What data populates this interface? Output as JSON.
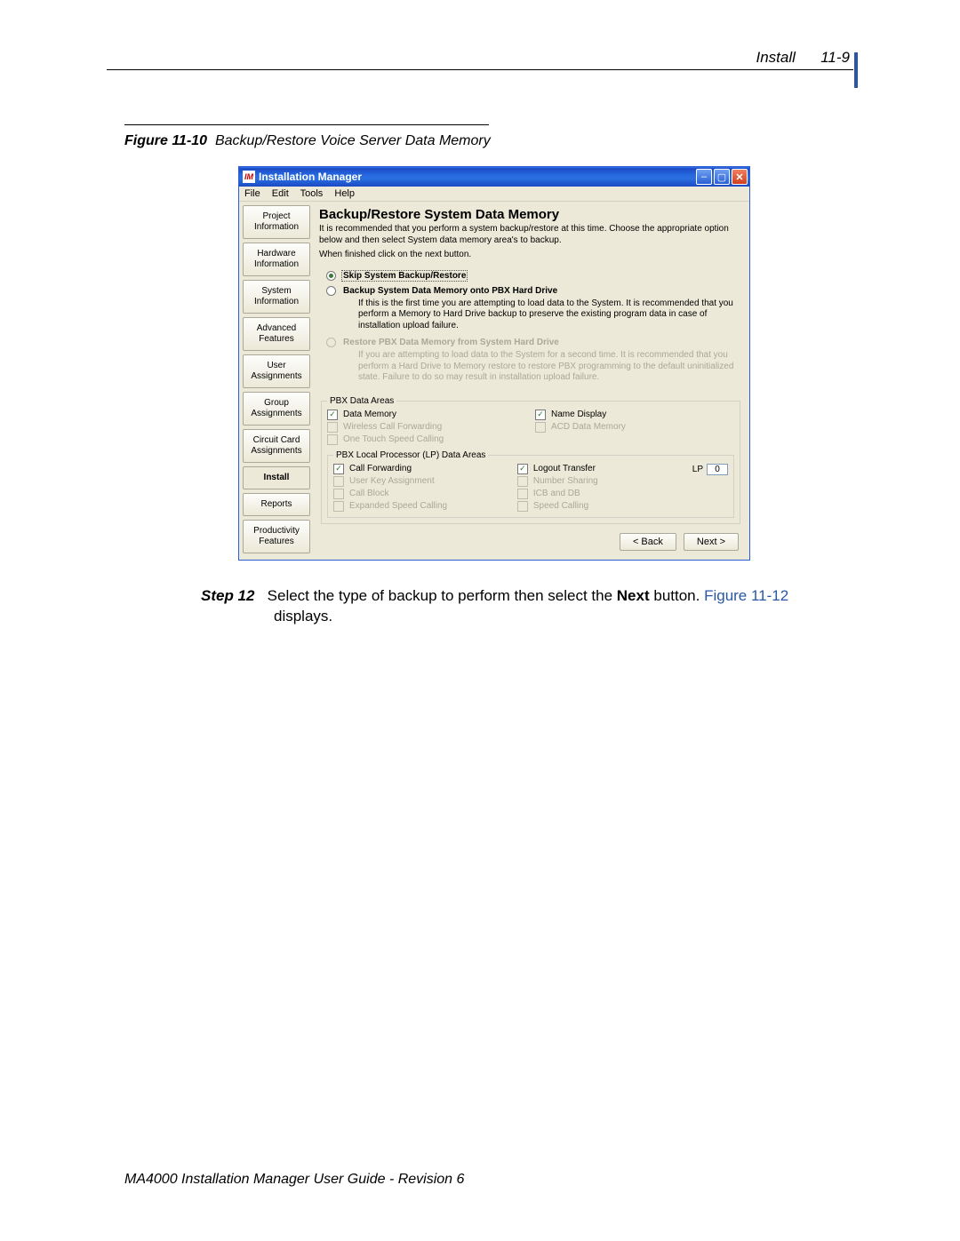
{
  "document": {
    "header_section": "Install",
    "header_page": "11-9",
    "figure_label": "Figure 11-10",
    "figure_title": "Backup/Restore Voice Server Data Memory",
    "step_label": "Step 12",
    "step_text_1": "Select the type of backup to perform then select the ",
    "step_text_bold": "Next",
    "step_text_2": " button. ",
    "step_figref": "Figure 11-12",
    "step_text_3": " displays.",
    "footer": "MA4000 Installation Manager User Guide - Revision 6"
  },
  "window": {
    "title": "Installation Manager",
    "menus": [
      "File",
      "Edit",
      "Tools",
      "Help"
    ],
    "sidebar": [
      "Project Information",
      "Hardware Information",
      "System Information",
      "Advanced Features",
      "User Assignments",
      "Group Assignments",
      "Circuit Card Assignments",
      "Install",
      "Reports",
      "Productivity Features"
    ],
    "sidebar_active_index": 7,
    "panel": {
      "title": "Backup/Restore System Data Memory",
      "desc1": "It is recommended that you perform a system backup/restore at this time.  Choose the appropriate option below and then select System data memory area's to backup.",
      "desc2": "When finished click on the next button.",
      "radios": [
        {
          "label": "Skip System Backup/Restore",
          "selected": true,
          "enabled": true,
          "sub": null
        },
        {
          "label": "Backup System Data Memory onto PBX Hard Drive",
          "selected": false,
          "enabled": true,
          "sub": "If this is the first time you are attempting to load data to the System. It is recommended that you perform a Memory to Hard Drive backup to preserve the existing program data in case of installation upload failure."
        },
        {
          "label": "Restore PBX Data Memory from System Hard Drive",
          "selected": false,
          "enabled": false,
          "sub": "If you are attempting to load data to the System for a second time.  It is recommended that you perform a Hard Drive to Memory restore to restore PBX programming to the default uninitialized state.  Failure to do so may result in installation upload failure."
        }
      ],
      "pbx_legend": "PBX Data Areas",
      "pbx_items": [
        {
          "label": "Data Memory",
          "checked": true,
          "enabled": true
        },
        {
          "label": "Name Display",
          "checked": true,
          "enabled": true
        },
        {
          "label": "Wireless Call Forwarding",
          "checked": false,
          "enabled": false
        },
        {
          "label": "ACD Data Memory",
          "checked": false,
          "enabled": false
        },
        {
          "label": "One Touch Speed Calling",
          "checked": false,
          "enabled": false
        }
      ],
      "lp_legend": "PBX Local Processor (LP) Data Areas",
      "lp_label": "LP",
      "lp_value": "0",
      "lp_items": [
        {
          "label": "Call Forwarding",
          "checked": true,
          "enabled": true
        },
        {
          "label": "Logout Transfer",
          "checked": true,
          "enabled": true
        },
        {
          "label": "User Key Assignment",
          "checked": false,
          "enabled": false
        },
        {
          "label": "Number Sharing",
          "checked": false,
          "enabled": false
        },
        {
          "label": "Call Block",
          "checked": false,
          "enabled": false
        },
        {
          "label": "ICB and DB",
          "checked": false,
          "enabled": false
        },
        {
          "label": "Expanded Speed Calling",
          "checked": false,
          "enabled": false
        },
        {
          "label": "Speed Calling",
          "checked": false,
          "enabled": false
        }
      ],
      "back_label": "< Back",
      "next_label": "Next >"
    }
  }
}
